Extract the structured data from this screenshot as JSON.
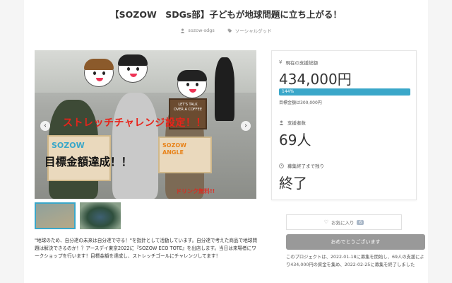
{
  "project": {
    "title": "【SOZOW　SDGs部】子どもが地球問題に立ち上がる！",
    "author": "sozow-sdgs",
    "category": "ソーシャルグッド"
  },
  "hero": {
    "challenge_text": "ストレッチチャレンジ設定！！",
    "achieved_text": "目標金額達成！！",
    "board_text_1": "SOZOW",
    "board_text_2": "SOZOW ANGLE",
    "speech_text": "LET'S TALK OVER A COFFEE",
    "bottom_text": "ドリンク無料!!",
    "prev_arrow": "‹",
    "next_arrow": "›"
  },
  "description": "\"地球のため、自分達の未来は自分達で守る！\"を指針として活動しています。自分達で考えた商品で地球問題は解決できるのか！？アースデイ東京2022に『SOZOW ECO TOTE』を出店します。当日は来場者にワークショップを行います！目標金額を達成し、ストレッチゴールにチャレンジしてます！",
  "stats": {
    "amount_label": "現在の支援総額",
    "amount_value": "434,000円",
    "progress_text": "144%",
    "progress_value": 144,
    "goal_text": "目標金額は300,000円",
    "supporters_label": "支援者数",
    "supporters_value": "69人",
    "remaining_label": "募集終了まで残り",
    "remaining_value": "終了"
  },
  "actions": {
    "favorite_label": "お気に入り",
    "favorite_count": "6",
    "thanks_label": "おめでとうございます"
  },
  "notice": "このプロジェクトは、2022-01-18に募集を開始し、69人の支援により434,000円の資金を集め、2022-02-25に募集を終了しました",
  "colors": {
    "accent": "#3aa7c9",
    "hero_red": "#e8231a",
    "button_gray": "#999999"
  }
}
